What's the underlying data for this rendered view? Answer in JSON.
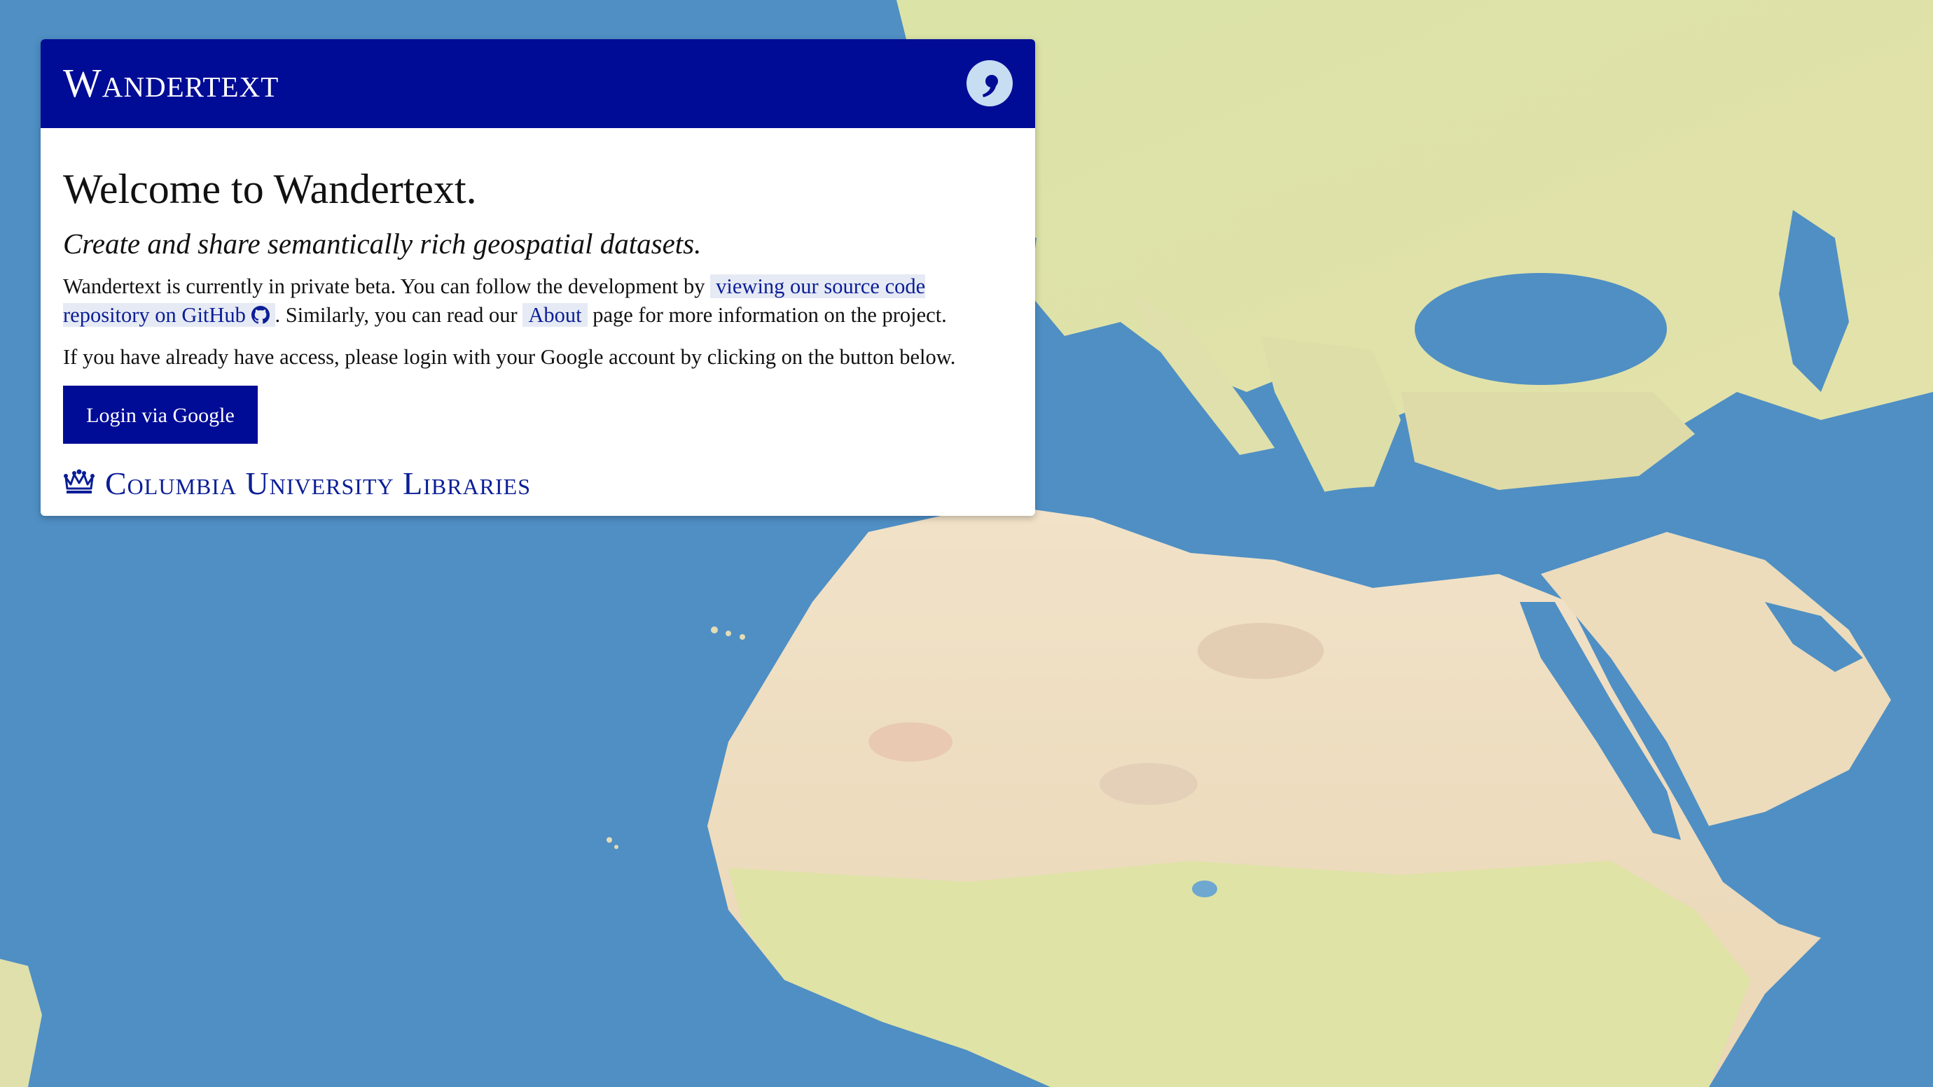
{
  "app": {
    "brand": "Wandertext",
    "logo_icon": "quote-mark-icon"
  },
  "welcome": {
    "heading": "Welcome to Wandertext.",
    "tagline": "Create and share semantically rich geospatial datasets.",
    "beta_text_1": "Wandertext is currently in private beta. You can follow the development by ",
    "github_link": "viewing our source code repository on GitHub",
    "beta_text_2": ". Similarly, you can read our ",
    "about_link": "About",
    "beta_text_3": " page for more information on the project.",
    "access_text": "If you have already have access, please login with your Google account by clicking on the button below.",
    "login_button": "Login via Google"
  },
  "footer": {
    "institution": "Columbia University Libraries",
    "institution_icon": "crown-icon"
  },
  "colors": {
    "brand_blue": "#000c96",
    "link_blue": "#0b1e96",
    "link_bg": "#e6eaf4",
    "ocean": "#4f8fc4"
  }
}
